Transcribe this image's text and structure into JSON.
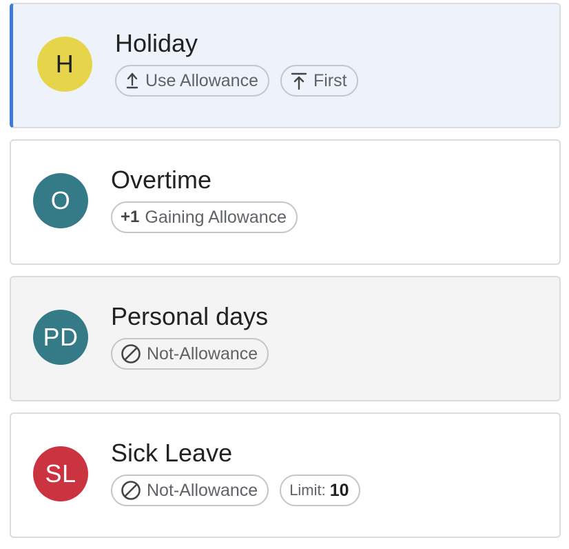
{
  "categories": [
    {
      "avatar": "H",
      "avatar_color": "#e6d54b",
      "avatar_text_color": "#202124",
      "title": "Holiday",
      "selected": true,
      "chips": [
        {
          "icon": "upload-icon",
          "label": "Use Allowance"
        },
        {
          "icon": "arrow-up-to-line-icon",
          "label": "First"
        }
      ]
    },
    {
      "avatar": "O",
      "avatar_color": "#347a87",
      "avatar_text_color": "#ffffff",
      "title": "Overtime",
      "chips": [
        {
          "icon_text": "+1",
          "label": "Gaining Allowance"
        }
      ]
    },
    {
      "avatar": "PD",
      "avatar_color": "#347a87",
      "avatar_text_color": "#ffffff",
      "title": "Personal days",
      "greyed": true,
      "chips": [
        {
          "icon": "block-icon",
          "label": "Not-Allowance"
        }
      ]
    },
    {
      "avatar": "SL",
      "avatar_color": "#cc3340",
      "avatar_text_color": "#ffffff",
      "title": "Sick Leave",
      "chips": [
        {
          "icon": "block-icon",
          "label": "Not-Allowance"
        },
        {
          "limit_label": "Limit:",
          "limit_value": "10"
        }
      ]
    }
  ]
}
